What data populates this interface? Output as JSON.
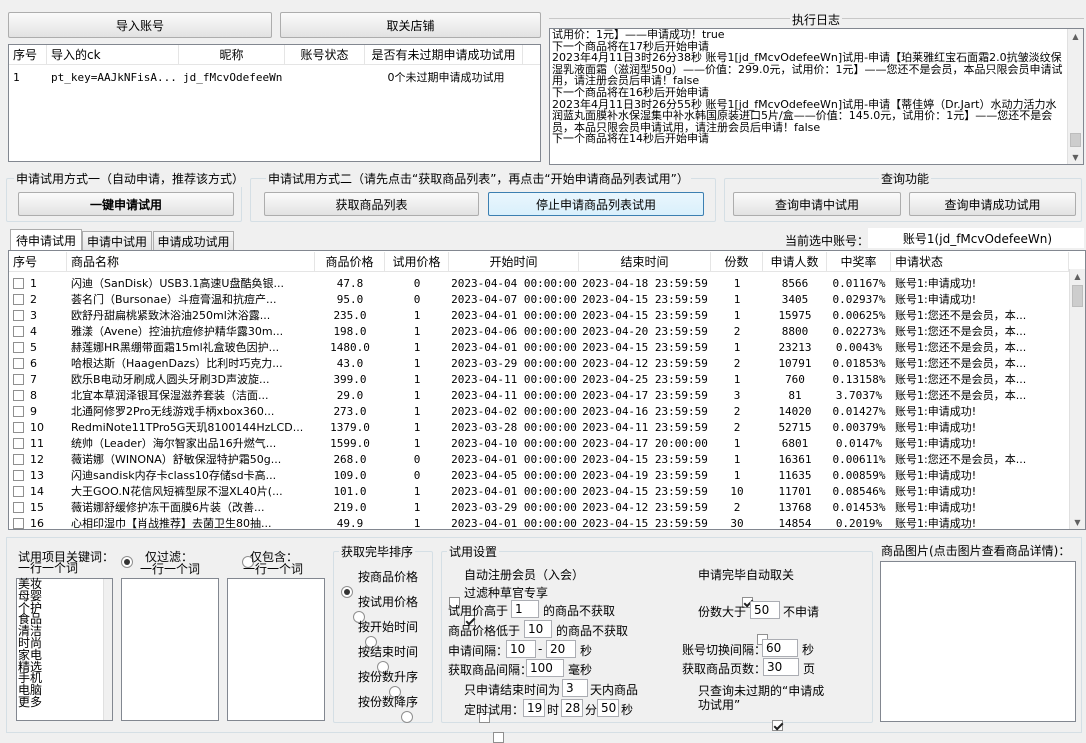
{
  "top_buttons": {
    "import": "导入账号",
    "unfollow": "取关店铺"
  },
  "accounts": {
    "columns": [
      "序号",
      "导入的ck",
      "昵称",
      "账号状态",
      "是否有未过期申请成功试用"
    ],
    "rows": [
      [
        "1",
        "pt_key=AAJkNFisA...",
        "jd_fMcvOdefeeWn",
        "",
        "0个未过期申请成功试用"
      ]
    ]
  },
  "log": {
    "title": "执行日志",
    "lines": [
      "试用价：1元】——申请成功！true",
      "下一个商品将在17秒后开始申请",
      "2023年4月11日3时26分38秒 账号1[jd_fMcvOdefeeWn]试用-申请【珀莱雅红宝石面霜2.0抗皱淡纹保湿乳液面霜（滋润型50g）——价值：299.0元，试用价：1元】——您还不是会员，本品只限会员申请试用，请注册会员后申请！false",
      "下一个商品将在16秒后开始申请",
      "2023年4月11日3时26分55秒 账号1[jd_fMcvOdefeeWn]试用-申请【蒂佳婷（Dr.Jart）水动力活力水润蓝丸面膜补水保湿集中补水韩国原装进口5片/盒——价值：145.0元，试用价：1元】——您还不是会员，本品只限会员申请试用，请注册会员后申请！false",
      "下一个商品将在14秒后开始申请"
    ]
  },
  "mode1": {
    "title": "申请试用方式一（自动申请，推荐该方式）",
    "button": "一键申请试用"
  },
  "mode2": {
    "title": "申请试用方式二（请先点击“获取商品列表”，再点击“开始申请商品列表试用”）",
    "get_list": "获取商品列表",
    "stop": "停止申请商品列表试用"
  },
  "query": {
    "title": "查询功能",
    "in_progress": "查询申请中试用",
    "success": "查询申请成功试用"
  },
  "tabs": [
    "待申请试用",
    "申请中试用",
    "申请成功试用"
  ],
  "current_account": {
    "label": "当前选中账号：",
    "value": "账号1(jd_fMcvOdefeeWn)"
  },
  "products": {
    "columns": [
      "序号",
      "商品名称",
      "商品价格",
      "试用价格",
      "开始时间",
      "结束时间",
      "份数",
      "申请人数",
      "中奖率",
      "申请状态"
    ],
    "rows": [
      [
        "1",
        "闪迪（SanDisk）USB3.1高速U盘酷奂银...",
        "47.8",
        "0",
        "2023-04-04 00:00:00",
        "2023-04-18 23:59:59",
        "1",
        "8566",
        "0.01167%",
        "账号1:申请成功!"
      ],
      [
        "2",
        "荟名门（Bursonae）斗痘膏温和抗痘产...",
        "95.0",
        "0",
        "2023-04-07 00:00:00",
        "2023-04-15 23:59:59",
        "1",
        "3405",
        "0.02937%",
        "账号1:申请成功!"
      ],
      [
        "3",
        "欧舒丹甜扁桃紧致沐浴油250ml沐浴露...",
        "235.0",
        "1",
        "2023-04-01 00:00:00",
        "2023-04-15 23:59:59",
        "1",
        "15975",
        "0.00625%",
        "账号1:您还不是会员，本..."
      ],
      [
        "4",
        "雅漾（Avene）控油抗痘修护精华露30m...",
        "198.0",
        "1",
        "2023-04-06 00:00:00",
        "2023-04-20 23:59:59",
        "2",
        "8800",
        "0.02273%",
        "账号1:您还不是会员，本..."
      ],
      [
        "5",
        "赫莲娜HR黑绷带面霜15ml礼盒玻色因护...",
        "1480.0",
        "1",
        "2023-04-01 00:00:00",
        "2023-04-15 23:59:59",
        "1",
        "23213",
        "0.0043%",
        "账号1:您还不是会员，本..."
      ],
      [
        "6",
        "哈根达斯（HaagenDazs）比利时巧克力...",
        "43.0",
        "1",
        "2023-03-29 00:00:00",
        "2023-04-12 23:59:59",
        "2",
        "10791",
        "0.01853%",
        "账号1:您还不是会员，本..."
      ],
      [
        "7",
        "欧乐B电动牙刷成人圆头牙刷3D声波旋...",
        "399.0",
        "1",
        "2023-04-11 00:00:00",
        "2023-04-25 23:59:59",
        "1",
        "760",
        "0.13158%",
        "账号1:您还不是会员，本..."
      ],
      [
        "8",
        "北宜本草润泽银耳保湿滋养套装（洁面...",
        "29.0",
        "1",
        "2023-04-11 00:00:00",
        "2023-04-17 23:59:59",
        "3",
        "81",
        "3.7037%",
        "账号1:您还不是会员，本..."
      ],
      [
        "9",
        "北通阿修罗2Pro无线游戏手柄xbox360...",
        "273.0",
        "1",
        "2023-04-02 00:00:00",
        "2023-04-16 23:59:59",
        "2",
        "14020",
        "0.01427%",
        "账号1:申请成功!"
      ],
      [
        "10",
        "RedmiNote11TPro5G天玑8100144HzLCD...",
        "1379.0",
        "1",
        "2023-03-28 00:00:00",
        "2023-04-11 23:59:59",
        "2",
        "52715",
        "0.00379%",
        "账号1:申请成功!"
      ],
      [
        "11",
        "统帅（Leader）海尔智家出品16升燃气...",
        "1599.0",
        "1",
        "2023-04-10 00:00:00",
        "2023-04-17 20:00:00",
        "1",
        "6801",
        "0.0147%",
        "账号1:申请成功!"
      ],
      [
        "12",
        "薇诺娜（WINONA）舒敏保湿特护霜50g...",
        "268.0",
        "0",
        "2023-04-01 00:00:00",
        "2023-04-15 23:59:59",
        "1",
        "16361",
        "0.00611%",
        "账号1:您还不是会员，本..."
      ],
      [
        "13",
        "闪迪sandisk内存卡class10存储sd卡高...",
        "109.0",
        "0",
        "2023-04-05 00:00:00",
        "2023-04-19 23:59:59",
        "1",
        "11635",
        "0.00859%",
        "账号1:申请成功!"
      ],
      [
        "14",
        "大王GOO.N花信风短裤型尿不湿XL40片(...",
        "101.0",
        "1",
        "2023-04-01 00:00:00",
        "2023-04-15 23:59:59",
        "10",
        "11701",
        "0.08546%",
        "账号1:申请成功!"
      ],
      [
        "15",
        "薇诺娜舒缓修护冻干面膜6片装（改善...",
        "219.0",
        "1",
        "2023-03-29 00:00:00",
        "2023-04-12 23:59:59",
        "2",
        "13768",
        "0.01453%",
        "账号1:申请成功!"
      ],
      [
        "16",
        "心相印湿巾【肖战推荐】去菌卫生80抽...",
        "49.9",
        "1",
        "2023-04-01 00:00:00",
        "2023-04-15 23:59:59",
        "30",
        "14854",
        "0.2019%",
        "账号1:申请成功!"
      ]
    ]
  },
  "keywords": {
    "title": "试用项目关键词：",
    "hint": "一行一个词",
    "filter_only": "仅过滤：",
    "include_only": "仅包含：",
    "list": [
      "美妆",
      "母婴",
      "个护",
      "食品",
      "清洁",
      "时尚",
      "家电",
      "精选",
      "手机",
      "电脑",
      "更多"
    ]
  },
  "sort": {
    "title": "获取完毕排序",
    "options": [
      "按商品价格",
      "按试用价格",
      "按开始时间",
      "按结束时间",
      "按份数升序",
      "按份数降序"
    ],
    "selected": 0
  },
  "settings": {
    "title": "试用设置",
    "auto_register": "自动注册会员（入会）",
    "filter_drug": "过滤种草官专享",
    "price_above_pre": "试用价高于",
    "price_above_val": "1",
    "price_above_post": "的商品不获取",
    "price_below_pre": "商品价格低于",
    "price_below_val": "10",
    "price_below_post": "的商品不获取",
    "interval_label": "申请间隔：",
    "interval_min": "10",
    "interval_sep": "-",
    "interval_max": "20",
    "interval_unit": "秒",
    "fetch_interval_label": "获取商品间隔：",
    "fetch_interval_val": "100",
    "fetch_interval_unit": "毫秒",
    "end_within_label": "只申请结束时间为",
    "end_within_val": "3",
    "end_within_post": "天内商品",
    "timed_label": "定时试用：",
    "timed_h": "19",
    "timed_h_unit": "时",
    "timed_m": "28",
    "timed_m_unit": "分",
    "timed_s": "50",
    "timed_s_unit": "秒",
    "auto_unfollow": "申请完毕自动取关",
    "copies_above_pre": "份数大于",
    "copies_above_val": "50",
    "copies_above_post": "不申请",
    "switch_interval_label": "账号切换间隔：",
    "switch_interval_val": "60",
    "switch_interval_unit": "秒",
    "pages_label": "获取商品页数：",
    "pages_val": "30",
    "pages_unit": "页",
    "only_query_unexpired": "只查询未过期的“申请成功试用”"
  },
  "image_panel": {
    "title": "商品图片(点击图片查看商品详情)："
  }
}
